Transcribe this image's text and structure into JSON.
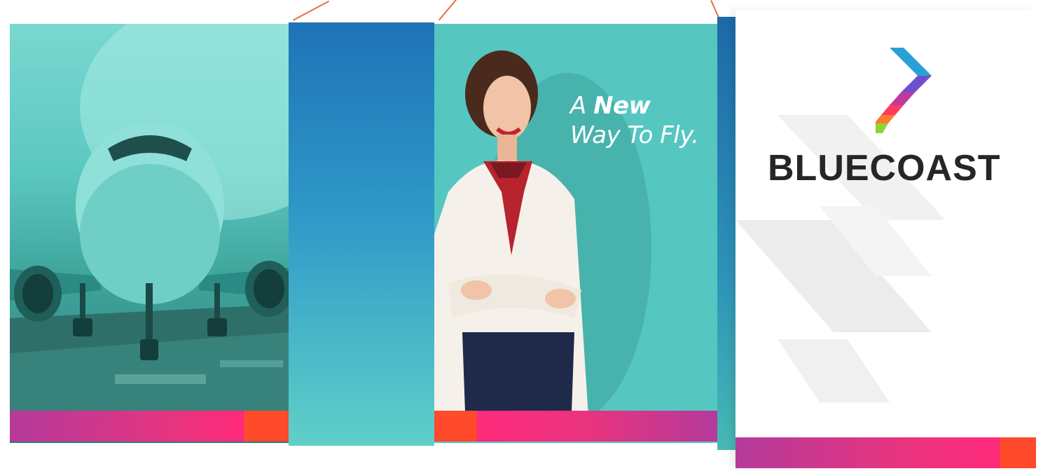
{
  "brand": {
    "name": "BLUECOAST"
  },
  "tagline": {
    "line1_prefix": "A",
    "line1_bold": "New",
    "line2": "Way To Fly."
  },
  "colors": {
    "teal": "#55c7c0",
    "blue": "#1e73b6",
    "pink_start": "#c0399f",
    "pink_end": "#ff2a7a",
    "orange": "#ff4a2c",
    "annotation_line": "#e5703a"
  }
}
